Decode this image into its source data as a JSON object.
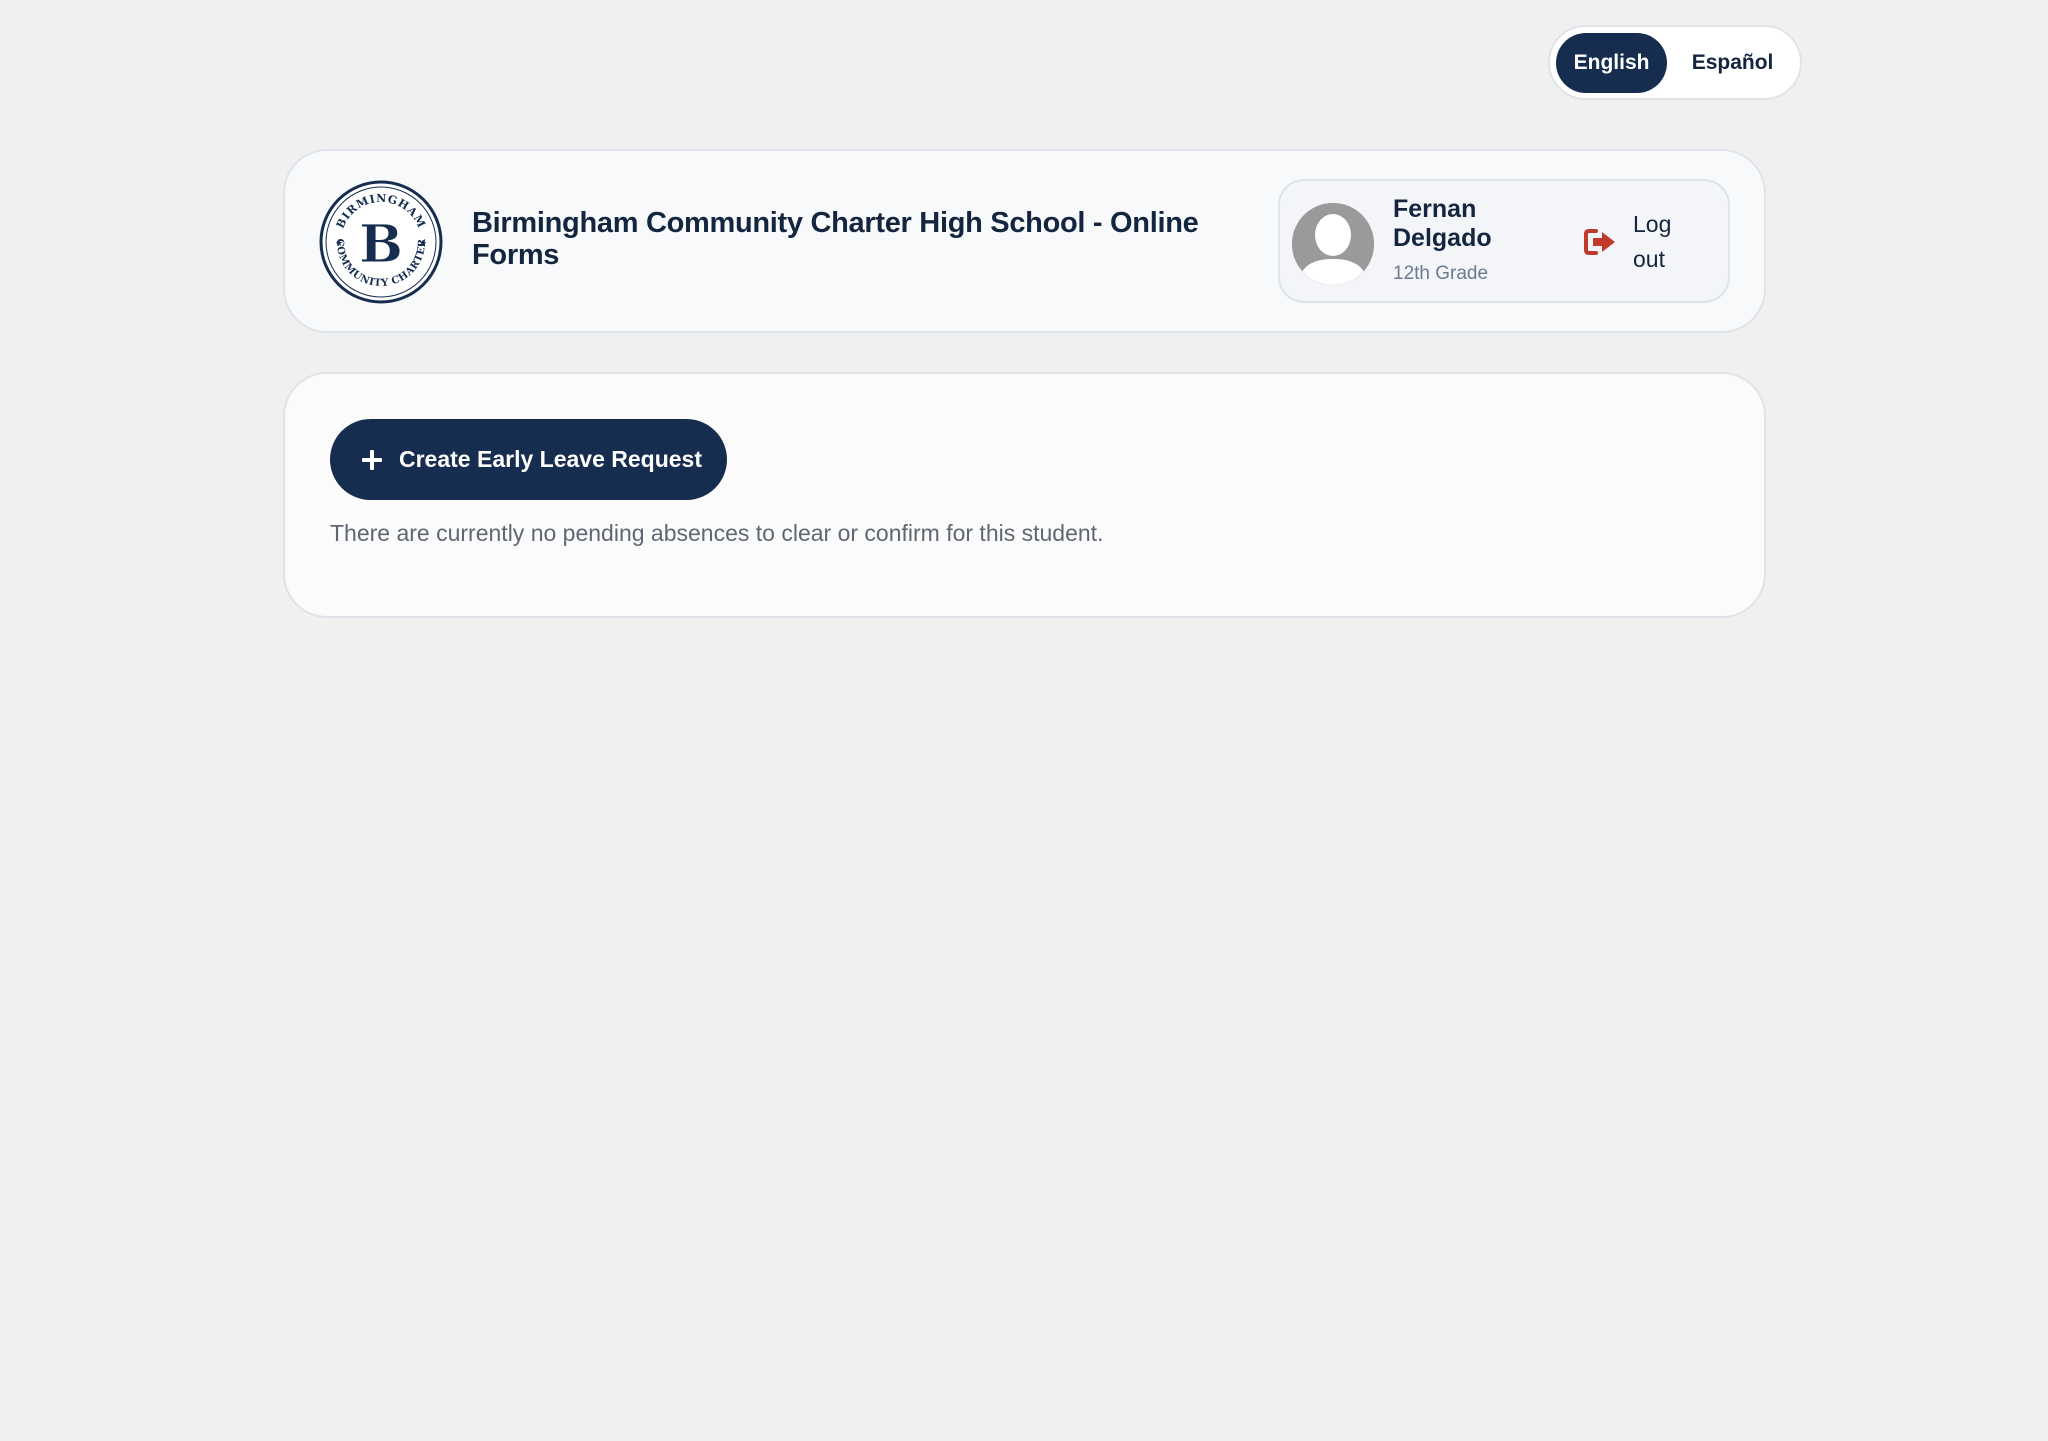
{
  "language": {
    "options": [
      "English",
      "Español"
    ],
    "active": "English"
  },
  "header": {
    "logo": {
      "top_text": "BIRMINGHAM",
      "bottom_text": "COMMUNITY CHARTER",
      "monogram": "B"
    },
    "title": "Birmingham Community Charter High School - Online Forms"
  },
  "user": {
    "name": "Fernan Delgado",
    "grade": "12th Grade",
    "logout_label": "Log out",
    "avatar_icon": "user-silhouette-icon",
    "logout_icon": "sign-out-icon"
  },
  "main": {
    "create_button_label": "Create Early Leave Request",
    "create_button_icon": "plus-icon",
    "empty_message": "There are currently no pending absences to clear or confirm for this student."
  },
  "colors": {
    "navy": "#162d4f",
    "logout_red": "#c0392b",
    "background": "#f0f0f0"
  }
}
